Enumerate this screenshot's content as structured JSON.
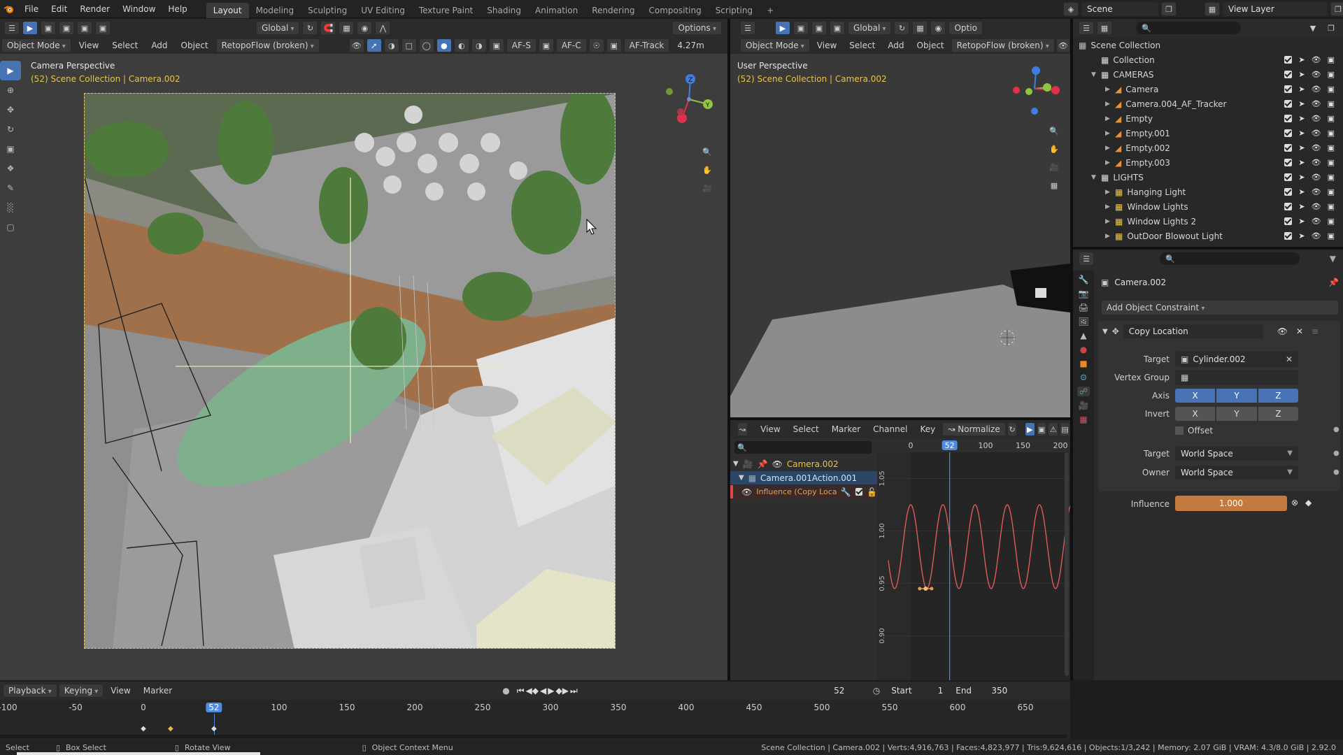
{
  "menubar": {
    "menus": [
      "File",
      "Edit",
      "Render",
      "Window",
      "Help"
    ],
    "workspaces": [
      "Layout",
      "Modeling",
      "Sculpting",
      "UV Editing",
      "Texture Paint",
      "Shading",
      "Animation",
      "Rendering",
      "Compositing",
      "Scripting"
    ],
    "active_workspace": "Layout",
    "add_tab": "+",
    "scene_label": "Scene",
    "view_layer_label": "View Layer"
  },
  "viewport_left": {
    "mode": "Object Mode",
    "menus": [
      "View",
      "Select",
      "Add",
      "Object"
    ],
    "addon_dropdown": "RetopoFlow (broken)",
    "orientation": "Global",
    "options": "Options",
    "af_s": "AF-S",
    "af_c": "AF-C",
    "af_track": "AF-Track",
    "distance": "4.27m",
    "title": "Camera Perspective",
    "subtitle": "(52) Scene Collection | Camera.002"
  },
  "viewport_right": {
    "mode": "Object Mode",
    "menus": [
      "View",
      "Select",
      "Add",
      "Object"
    ],
    "addon_dropdown": "RetopoFlow (broken)",
    "orientation": "Global",
    "options": "Optio",
    "title": "User Perspective",
    "subtitle": "(52) Scene Collection | Camera.002"
  },
  "outliner": {
    "root": "Scene Collection",
    "rows": [
      {
        "label": "Collection",
        "indent": 0,
        "kind": "collection"
      },
      {
        "label": "CAMERAS",
        "indent": 0,
        "kind": "collection"
      },
      {
        "label": "Camera",
        "indent": 1,
        "kind": "object"
      },
      {
        "label": "Camera.004_AF_Tracker",
        "indent": 1,
        "kind": "object"
      },
      {
        "label": "Empty",
        "indent": 1,
        "kind": "object"
      },
      {
        "label": "Empty.001",
        "indent": 1,
        "kind": "object"
      },
      {
        "label": "Empty.002",
        "indent": 1,
        "kind": "object"
      },
      {
        "label": "Empty.003",
        "indent": 1,
        "kind": "object"
      },
      {
        "label": "LIGHTS",
        "indent": 0,
        "kind": "collection"
      },
      {
        "label": "Hanging Light",
        "indent": 1,
        "kind": "light"
      },
      {
        "label": "Window Lights",
        "indent": 1,
        "kind": "light"
      },
      {
        "label": "Window Lights 2",
        "indent": 1,
        "kind": "light"
      },
      {
        "label": "OutDoor Blowout Light",
        "indent": 1,
        "kind": "light"
      }
    ]
  },
  "properties": {
    "object_name": "Camera.002",
    "add_constraint": "Add Object Constraint",
    "constraint_name": "Copy Location",
    "target_label": "Target",
    "target_value": "Cylinder.002",
    "vertex_group_label": "Vertex Group",
    "axis_label": "Axis",
    "invert_label": "Invert",
    "axes": [
      "X",
      "Y",
      "Z"
    ],
    "offset_label": "Offset",
    "target_space_label": "Target",
    "target_space_value": "World Space",
    "owner_space_label": "Owner",
    "owner_space_value": "World Space",
    "influence_label": "Influence",
    "influence_value": "1.000"
  },
  "graph_editor": {
    "menus": [
      "View",
      "Select",
      "Marker",
      "Channel",
      "Key"
    ],
    "normalize": "Normalize",
    "channels": [
      "Camera.002",
      "Camera.001Action.001",
      "Influence (Copy Locat"
    ],
    "frame_ticks": [
      "0",
      "52",
      "100",
      "150",
      "200"
    ],
    "value_ticks": [
      "1.05",
      "1.00",
      "0.95",
      "0.90"
    ],
    "current_frame": "52"
  },
  "timeline": {
    "menus": [
      "Playback",
      "Keying",
      "View",
      "Marker"
    ],
    "current_frame": "52",
    "start_label": "Start",
    "start_value": "1",
    "end_label": "End",
    "end_value": "350",
    "ticks": [
      "-100",
      "-50",
      "0",
      "52",
      "100",
      "150",
      "200",
      "250",
      "300",
      "350",
      "400",
      "450",
      "500",
      "550",
      "600",
      "650"
    ]
  },
  "statusbar": {
    "select": "Select",
    "box_select": "Box Select",
    "rotate_view": "Rotate View",
    "context_menu": "Object Context Menu",
    "stats": "Scene Collection | Camera.002 | Verts:4,916,763 | Faces:4,823,977 | Tris:9,624,616 | Objects:1/3,242 | Memory: 2.07 GiB | VRAM: 4.3/8.0 GiB | 2.92.0"
  },
  "colors": {
    "accent": "#4772b3",
    "influence": "#c27a3e",
    "curve": "#e05a5a",
    "playhead": "#4f8ce0"
  }
}
